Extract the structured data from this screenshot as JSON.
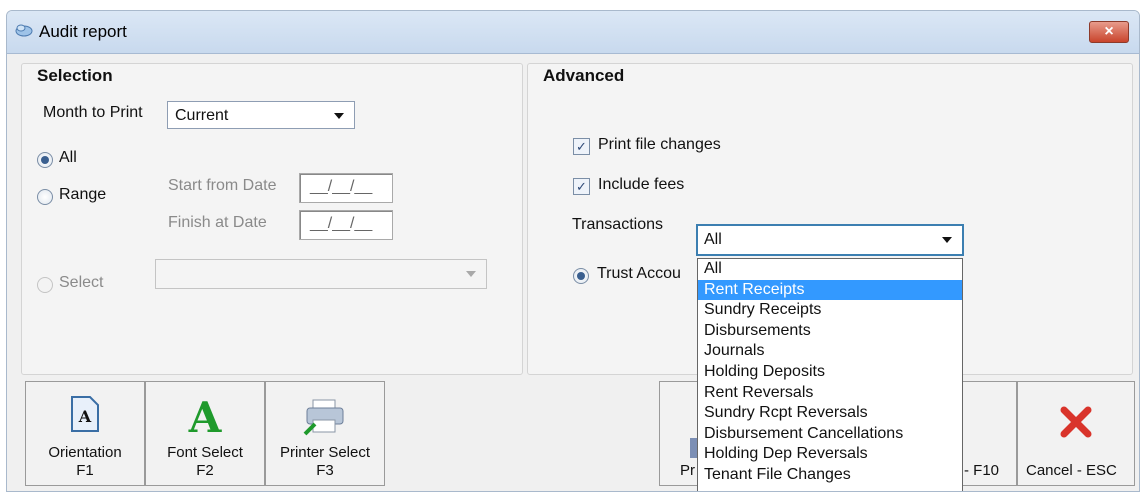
{
  "window": {
    "title": "Audit report",
    "close_label": "×"
  },
  "selection": {
    "title": "Selection",
    "month_label": "Month to Print",
    "month_value": "Current",
    "all_label": "All",
    "range_label": "Range",
    "start_label": "Start from Date",
    "start_value": "__/__/__",
    "finish_label": "Finish at Date",
    "finish_value": "__/__/__",
    "select_label": "Select",
    "select_value": ""
  },
  "advanced": {
    "title": "Advanced",
    "print_file_changes_label": "Print file changes",
    "print_file_changes_checked": true,
    "include_fees_label": "Include fees",
    "include_fees_checked": true,
    "transactions_label": "Transactions",
    "transactions_value": "All",
    "trust_label": "Trust Accou",
    "transactions_options": [
      "All",
      "Rent Receipts",
      "Sundry Receipts",
      "Disbursements",
      "Journals",
      "Holding Deposits",
      "Rent Reversals",
      "Sundry Rcpt Reversals",
      "Disbursement Cancellations",
      "Holding Dep Reversals",
      "Tenant File Changes"
    ],
    "highlighted_option": "Rent Receipts"
  },
  "toolbar": {
    "orientation": {
      "label": "Orientation",
      "key": "F1"
    },
    "font_select": {
      "label": "Font Select",
      "key": "F2"
    },
    "printer_select": {
      "label": "Printer Select",
      "key": "F3"
    },
    "preview_partial": "Pr",
    "print_partial": "- F10",
    "cancel": {
      "label": "Cancel - ESC"
    }
  },
  "colors": {
    "highlight": "#3399ff",
    "cancel_icon": "#d9342b",
    "font_icon": "#1f9a2c"
  }
}
